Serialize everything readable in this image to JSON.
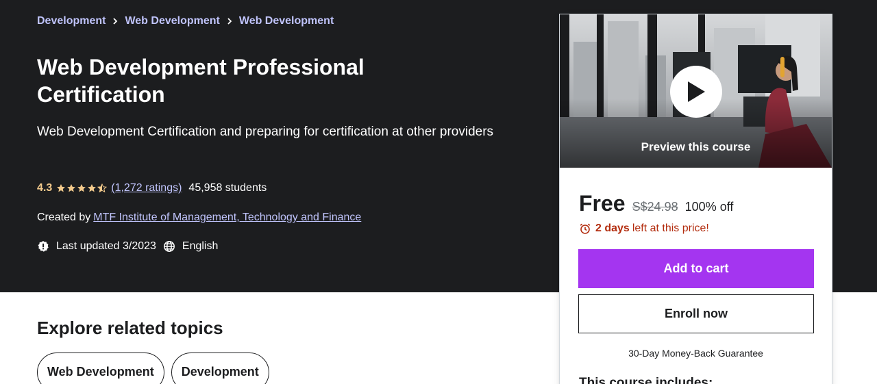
{
  "breadcrumb": [
    "Development",
    "Web Development",
    "Web Development"
  ],
  "course": {
    "title": "Web Development Professional Certification",
    "subtitle": "Web Development Certification and preparing for certification at other providers",
    "rating": "4.3",
    "ratings_count": "(1,272 ratings)",
    "students": "45,958 students",
    "created_by_label": "Created by",
    "instructor": "MTF Institute of Management, Technology and Finance",
    "last_updated": "Last updated 3/2023",
    "language": "English"
  },
  "sidebar": {
    "preview_label": "Preview this course",
    "price_now": "Free",
    "price_old": "S$24.98",
    "discount": "100% off",
    "timer_days": "2 days",
    "timer_rest": "left at this price!",
    "add_to_cart": "Add to cart",
    "enroll_now": "Enroll now",
    "guarantee": "30-Day Money-Back Guarantee",
    "includes_heading": "This course includes:"
  },
  "explore": {
    "title": "Explore related topics",
    "topics": [
      "Web Development",
      "Development"
    ]
  },
  "colors": {
    "hero_bg": "#1c1d1f",
    "link": "#c0c4fc",
    "rating": "#f3ca8c",
    "primary": "#a435f0",
    "alert": "#b32d0f"
  },
  "icons": [
    "chevron-right-icon",
    "star-icon",
    "half-star-icon",
    "alert-badge-icon",
    "globe-icon",
    "play-icon",
    "alarm-clock-icon"
  ]
}
